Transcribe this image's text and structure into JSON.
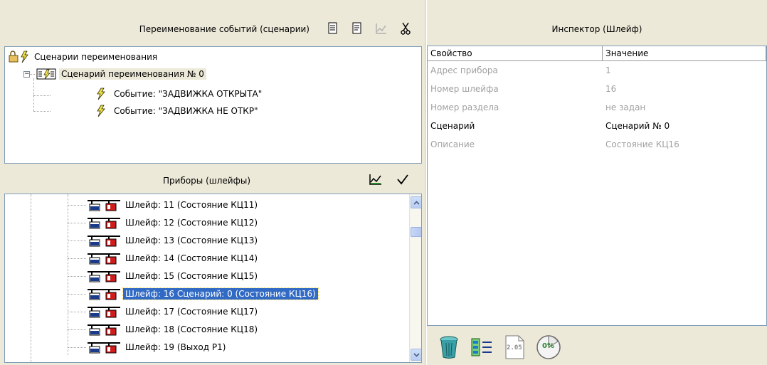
{
  "scenarios_panel": {
    "title": "Переименование событий (сценарии)",
    "tree": {
      "root": "Сценарии переименования",
      "scenario": "Сценарий переименования № 0",
      "events": [
        "Событие: \"ЗАДВИЖКА ОТКРЫТА\"",
        "Событие: \"ЗАДВИЖКА НЕ ОТКР\""
      ]
    }
  },
  "devices_panel": {
    "title": "Приборы (шлейфы)",
    "items": [
      "Шлейф: 11 (Состояние КЦ11)",
      "Шлейф: 12 (Состояние КЦ12)",
      "Шлейф: 13 (Состояние КЦ13)",
      "Шлейф: 14 (Состояние КЦ14)",
      "Шлейф: 15 (Состояние КЦ15)",
      "Шлейф: 16 Сценарий: 0 (Состояние КЦ16)",
      "Шлейф: 17 (Состояние КЦ17)",
      "Шлейф: 18 (Состояние КЦ18)",
      "Шлейф: 19 (Выход Р1)"
    ],
    "selected_index": 5
  },
  "inspector": {
    "title": "Инспектор (Шлейф)",
    "headers": [
      "Свойство",
      "Значение"
    ],
    "rows": [
      {
        "prop": "Адрес прибора",
        "value": "1"
      },
      {
        "prop": "Номер шлейфа",
        "value": "16"
      },
      {
        "prop": "Номер раздела",
        "value": "не задан"
      },
      {
        "prop": "Сценарий",
        "value": "Сценарий № 0"
      },
      {
        "prop": "Описание",
        "value": "Состояние КЦ16"
      }
    ],
    "tool_labels": {
      "version": "2.05",
      "percent": "0%"
    }
  },
  "colors": {
    "background": "#ece9d8",
    "selection": "#316ac5",
    "icon_red": "#d01c1c",
    "icon_green": "#2a8a2a"
  }
}
